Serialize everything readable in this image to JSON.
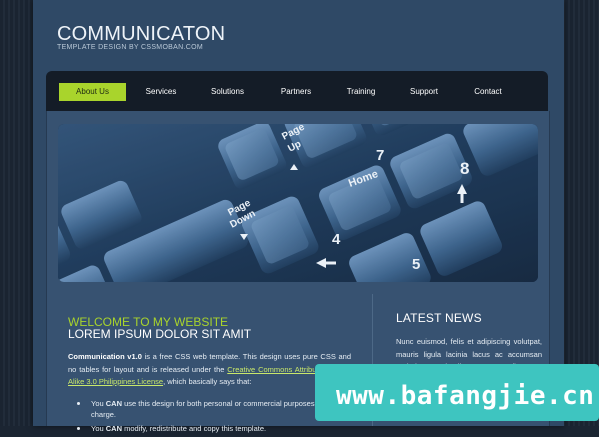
{
  "site": {
    "title": "COMMUNICATON",
    "tagline": "TEMPLATE DESIGN BY CSSMOBAN.COM"
  },
  "nav": {
    "items": [
      {
        "label": "About Us",
        "active": true
      },
      {
        "label": "Services",
        "active": false
      },
      {
        "label": "Solutions",
        "active": false
      },
      {
        "label": "Partners",
        "active": false
      },
      {
        "label": "Training",
        "active": false
      },
      {
        "label": "Support",
        "active": false
      },
      {
        "label": "Contact",
        "active": false
      }
    ]
  },
  "banner": {
    "keys": {
      "page_up": [
        "Page",
        "Up"
      ],
      "page_down": [
        "Page",
        "Down"
      ],
      "home": "Home",
      "seven": "7",
      "eight": "8",
      "four": "4",
      "five": "5"
    }
  },
  "main": {
    "welcome_line1": "WELCOME TO MY WEBSITE",
    "welcome_line2": "LOREM IPSUM DOLOR SIT AMIT",
    "intro_strong": "Communication v1.0",
    "intro_text_a": " is a free CSS web template. This design uses pure CSS and no tables for layout and is released under the ",
    "intro_link": "Creative Commons Attribution-Share Alike 3.0 Philippines License",
    "intro_text_b": ", which basically says that:",
    "bullets": [
      {
        "pre": "You ",
        "strong": "CAN",
        "post": " use this design for both personal or commercial purposes free of charge."
      },
      {
        "pre": "You ",
        "strong": "CAN",
        "post": " modify, redistribute and copy this template."
      }
    ]
  },
  "sidebar": {
    "news_title": "LATEST NEWS",
    "news_text": "Nunc euismod, felis et adipiscing volutpat, mauris ligula lacinia lacus ac accumsan pede lacus sed nulla. Integer ut nulla. Nunc euismod, felis et adipiscing volutpat, mauris ligula lacinia lacus ac"
  },
  "watermark": {
    "text": "www.bafangjie.cn"
  }
}
